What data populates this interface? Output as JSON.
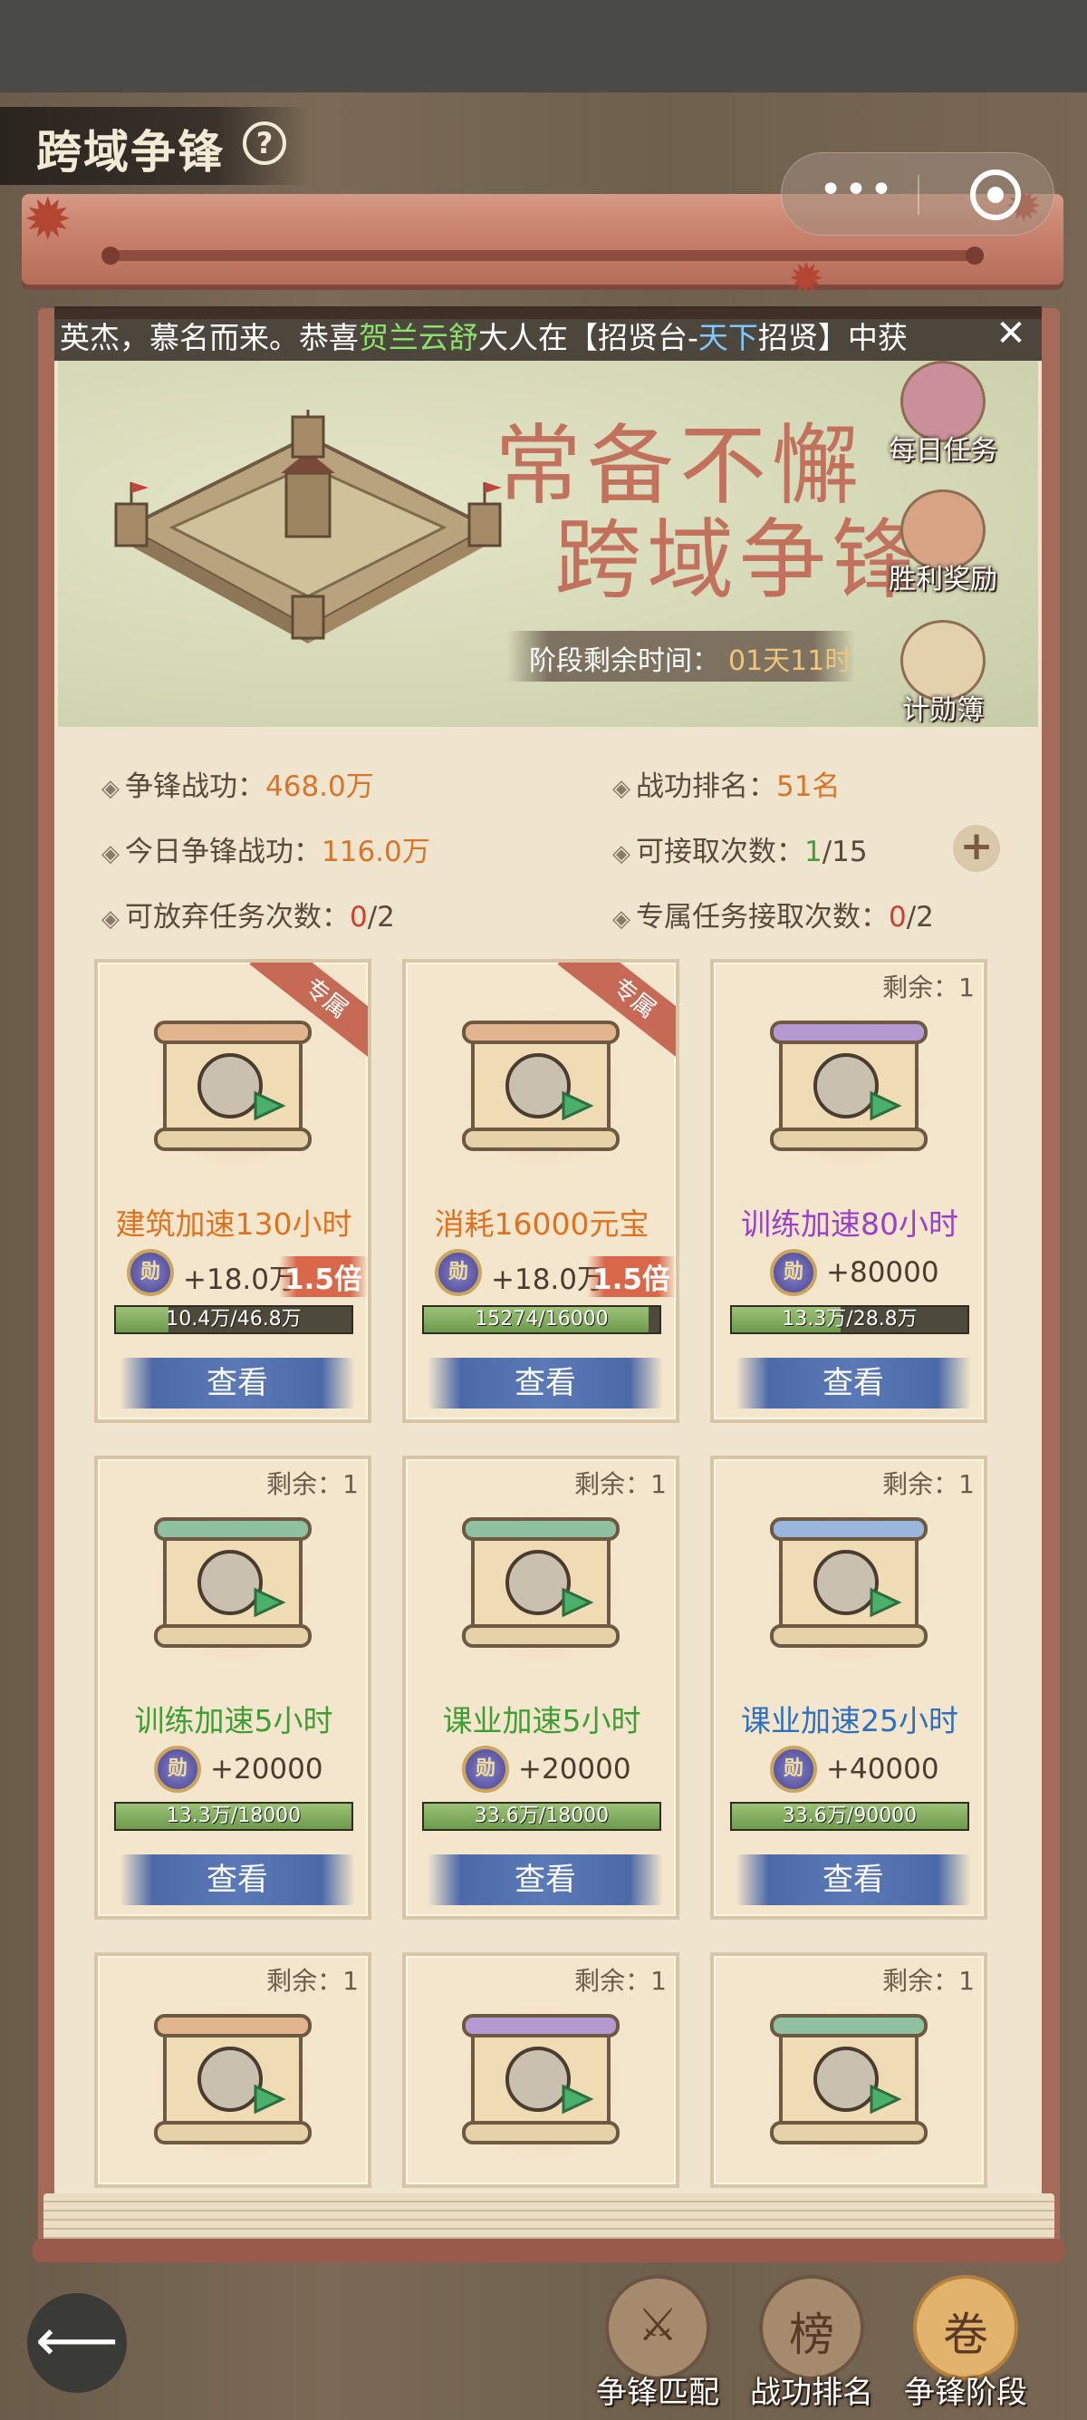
{
  "header": {
    "title": "跨域争锋",
    "help_icon": "question-circle-icon",
    "capsule": {
      "more_icon": "more-dots-icon",
      "close_icon": "target-circle-icon"
    }
  },
  "ticker": {
    "prefix": "英杰，慕名而来。恭喜",
    "player": "贺兰云舒",
    "middle": "大人在【招贤台-",
    "place": "天下",
    "suffix": "招贤】中获",
    "close_label": "✕"
  },
  "banner": {
    "line1": "常备不懈",
    "line2": "跨域争锋",
    "time_label": "阶段剩余时间：",
    "time_value": "01天11时",
    "side_buttons": [
      {
        "label": "每日任务",
        "icon": "treasure-chest-icon"
      },
      {
        "label": "胜利奖励",
        "icon": "reward-scroll-icon"
      },
      {
        "label": "计勋簿",
        "icon": "merit-book-icon"
      }
    ]
  },
  "stats": {
    "contribution_label": "争锋战功：",
    "contribution_value": "468.0万",
    "rank_label": "战功排名：",
    "rank_value": "51名",
    "today_label": "今日争锋战功：",
    "today_value": "116.0万",
    "accept_label": "可接取次数：",
    "accept_current": "1",
    "accept_total": "/15",
    "abandon_label": "可放弃任务次数：",
    "abandon_current": "0",
    "abandon_total": "/2",
    "exclusive_label": "专属任务接取次数：",
    "exclusive_current": "0",
    "exclusive_total": "/2",
    "add_icon": "plus-icon"
  },
  "tasks": [
    {
      "ribbon": "专属",
      "remain": "",
      "name": "建筑加速130小时",
      "color": "orange",
      "reward": "+18.0万",
      "multiplier": "1.5倍",
      "progress_text": "10.4万/46.8万",
      "progress": 0.222,
      "view": "查看",
      "icon": "hammer-icon",
      "scroll_color": "#e3b58e"
    },
    {
      "ribbon": "专属",
      "remain": "",
      "name": "消耗16000元宝",
      "color": "orange",
      "reward": "+18.0万",
      "multiplier": "1.5倍",
      "progress_text": "15274/16000",
      "progress": 0.955,
      "view": "查看",
      "icon": "gold-ingot-icon",
      "scroll_color": "#e3b58e"
    },
    {
      "ribbon": "",
      "remain": "剩余：1",
      "name": "训练加速80小时",
      "color": "purple",
      "reward": "+80000",
      "multiplier": "",
      "progress_text": "13.3万/28.8万",
      "progress": 0.462,
      "view": "查看",
      "icon": "soldier-icon",
      "scroll_color": "#b49ad0"
    },
    {
      "ribbon": "",
      "remain": "剩余：1",
      "name": "训练加速5小时",
      "color": "green",
      "reward": "+20000",
      "multiplier": "",
      "progress_text": "13.3万/18000",
      "progress": 1,
      "view": "查看",
      "icon": "soldier-icon",
      "scroll_color": "#8fc0a0"
    },
    {
      "ribbon": "",
      "remain": "剩余：1",
      "name": "课业加速5小时",
      "color": "green",
      "reward": "+20000",
      "multiplier": "",
      "progress_text": "33.6万/18000",
      "progress": 1,
      "view": "查看",
      "icon": "book-icon",
      "scroll_color": "#8fc0a0"
    },
    {
      "ribbon": "",
      "remain": "剩余：1",
      "name": "课业加速25小时",
      "color": "blue",
      "reward": "+40000",
      "multiplier": "",
      "progress_text": "33.6万/90000",
      "progress": 1,
      "view": "查看",
      "icon": "book-icon",
      "scroll_color": "#9ab6dc"
    },
    {
      "ribbon": "",
      "remain": "剩余：1",
      "name": "",
      "color": "orange",
      "reward": "",
      "multiplier": "",
      "progress_text": "",
      "progress": 0,
      "view": "",
      "icon": "gold-ingot-icon",
      "scroll_color": "#e3b58e"
    },
    {
      "ribbon": "",
      "remain": "剩余：1",
      "name": "",
      "color": "purple",
      "reward": "",
      "multiplier": "",
      "progress_text": "",
      "progress": 0,
      "view": "",
      "icon": "coins-icon",
      "scroll_color": "#b49ad0"
    },
    {
      "ribbon": "",
      "remain": "剩余：1",
      "name": "",
      "color": "green",
      "reward": "",
      "multiplier": "",
      "progress_text": "",
      "progress": 0,
      "view": "",
      "icon": "bandit-icon",
      "scroll_color": "#8fc0a0"
    }
  ],
  "bottom_nav": {
    "back_icon": "back-arrow-icon",
    "items": [
      {
        "label": "争锋匹配",
        "glyph": "⚔",
        "icon": "soldiers-icon",
        "active": false
      },
      {
        "label": "战功排名",
        "glyph": "榜",
        "icon": "ranking-board-icon",
        "active": false
      },
      {
        "label": "争锋阶段",
        "glyph": "卷",
        "icon": "stage-scroll-icon",
        "active": true
      }
    ]
  }
}
